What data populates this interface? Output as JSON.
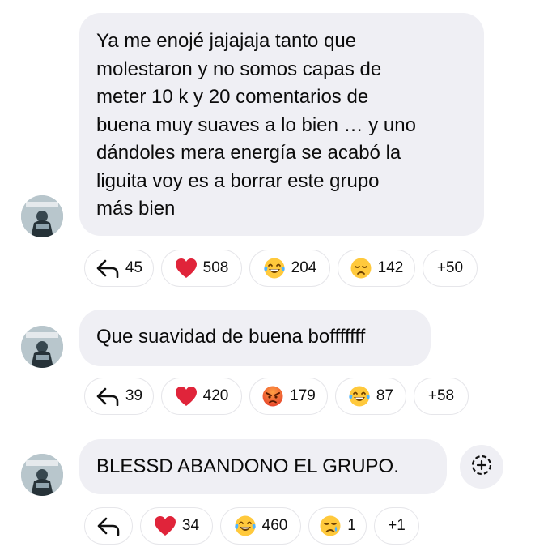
{
  "comments": [
    {
      "text": "Ya me enojé jajajaja tanto que\nmolestaron y no somos capas de\nmeter 10 k y 20 comentarios de\nbuena muy suaves a lo bien … y uno\ndándoles mera energía se acabó la\nliguita voy es a borrar este grupo\nmás bien",
      "reply_count": "45",
      "reactions": [
        {
          "icon": "heart-emoji",
          "count": "508"
        },
        {
          "icon": "laughing-tears-emoji",
          "count": "204"
        },
        {
          "icon": "sad-face-emoji",
          "count": "142"
        }
      ],
      "more": "+50"
    },
    {
      "text": "Que suavidad de buena bofffffff",
      "reply_count": "39",
      "reactions": [
        {
          "icon": "heart-emoji",
          "count": "420"
        },
        {
          "icon": "angry-face-emoji",
          "count": "179"
        },
        {
          "icon": "laughing-tears-emoji",
          "count": "87"
        }
      ],
      "more": "+58"
    },
    {
      "text": "BLESSD ABANDONO EL GRUPO.",
      "reply_count": "",
      "reactions": [
        {
          "icon": "heart-emoji",
          "count": "34"
        },
        {
          "icon": "laughing-tears-emoji",
          "count": "460"
        },
        {
          "icon": "crying-face-emoji",
          "count": "1"
        }
      ],
      "more": "+1"
    }
  ],
  "add_reaction_icon": "add-reaction-icon",
  "colors": {
    "bubble": "#efeff4",
    "pill_border": "#e6e6ea",
    "heart": "#e0243a",
    "emoji_yellow": "#ffc93c"
  }
}
